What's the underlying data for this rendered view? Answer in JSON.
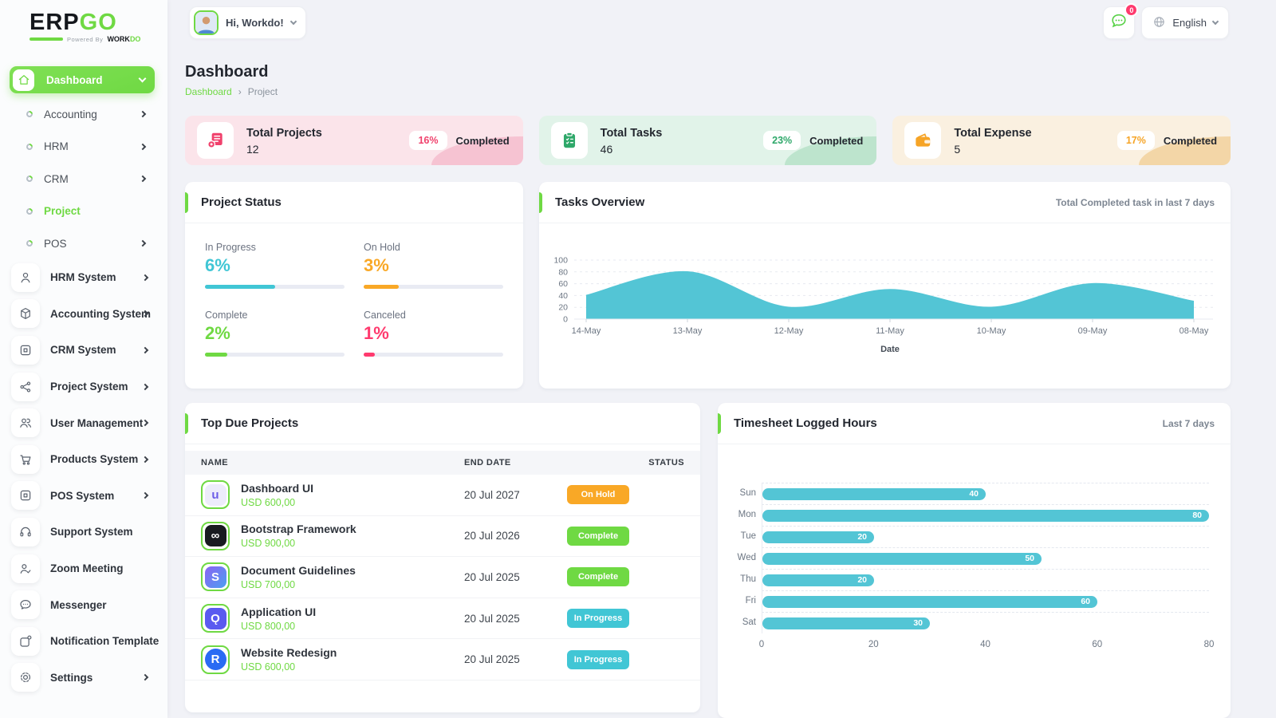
{
  "colors": {
    "primary": "#6fd943",
    "teal": "#53c5d5",
    "orange": "#f9a826",
    "pink": "#ff3a6e"
  },
  "brand": {
    "logo_erp": "ERP",
    "logo_go": "GO",
    "powered_by": "Powered By",
    "workdo_work": "WORK",
    "workdo_do": "DO"
  },
  "header": {
    "user_greeting": "Hi, Workdo!",
    "language": "English",
    "notification_count": "0"
  },
  "page": {
    "title": "Dashboard",
    "breadcrumb_home": "Dashboard",
    "breadcrumb_separator": "›",
    "breadcrumb_current": "Project"
  },
  "sidebar": {
    "dashboard_label": "Dashboard",
    "submenu": [
      {
        "label": "Accounting",
        "chevron": true,
        "active": false
      },
      {
        "label": "HRM",
        "chevron": true,
        "active": false
      },
      {
        "label": "CRM",
        "chevron": true,
        "active": false
      },
      {
        "label": "Project",
        "chevron": false,
        "active": true
      },
      {
        "label": "POS",
        "chevron": true,
        "active": false
      }
    ],
    "modules": [
      {
        "label": "HRM System",
        "icon": "user-icon",
        "chevron": true
      },
      {
        "label": "Accounting System",
        "icon": "cube-icon",
        "chevron": true
      },
      {
        "label": "CRM System",
        "icon": "display-icon",
        "chevron": true
      },
      {
        "label": "Project System",
        "icon": "share-icon",
        "chevron": true
      },
      {
        "label": "User Management",
        "icon": "users-icon",
        "chevron": true
      },
      {
        "label": "Products System",
        "icon": "cart-icon",
        "chevron": true
      },
      {
        "label": "POS System",
        "icon": "display-icon",
        "chevron": true
      },
      {
        "label": "Support System",
        "icon": "headset-icon",
        "chevron": false
      },
      {
        "label": "Zoom Meeting",
        "icon": "person-check-icon",
        "chevron": false
      },
      {
        "label": "Messenger",
        "icon": "chat-icon",
        "chevron": false
      },
      {
        "label": "Notification Template",
        "icon": "template-icon",
        "chevron": false
      },
      {
        "label": "Settings",
        "icon": "gear-icon",
        "chevron": true
      }
    ]
  },
  "stat_cards": [
    {
      "title": "Total Projects",
      "value": "12",
      "percent": "16%",
      "completed_label": "Completed",
      "icon": "projects-icon",
      "bg": "#fbe4ea",
      "corner": "#f6c3d2",
      "accent": "#f0416c"
    },
    {
      "title": "Total Tasks",
      "value": "46",
      "percent": "23%",
      "completed_label": "Completed",
      "icon": "tasks-icon",
      "bg": "#e1f3e9",
      "corner": "#bde4cd",
      "accent": "#2fa86a"
    },
    {
      "title": "Total Expense",
      "value": "5",
      "percent": "17%",
      "completed_label": "Completed",
      "icon": "wallet-icon",
      "bg": "#faf0e0",
      "corner": "#f3d6a7",
      "accent": "#f6a426"
    }
  ],
  "project_status": {
    "title": "Project Status",
    "items": [
      {
        "label": "In Progress",
        "value": "6%",
        "color": "#41c6d5",
        "fill_pct": 50
      },
      {
        "label": "On Hold",
        "value": "3%",
        "color": "#f9a826",
        "fill_pct": 25
      },
      {
        "label": "Complete",
        "value": "2%",
        "color": "#6fd943",
        "fill_pct": 16
      },
      {
        "label": "Canceled",
        "value": "1%",
        "color": "#ff3a6e",
        "fill_pct": 8
      }
    ]
  },
  "tasks_overview": {
    "title": "Tasks Overview",
    "subtitle": "Total Completed task in last 7 days"
  },
  "top_due_projects": {
    "title": "Top Due Projects",
    "columns": [
      "NAME",
      "END DATE",
      "STATUS"
    ],
    "rows": [
      {
        "name": "Dashboard UI",
        "price": "USD 600,00",
        "end_date": "20 Jul 2027",
        "status": "On Hold",
        "status_color": "#f9a826",
        "logo_bg": "#edecfb",
        "logo_glyph": "u",
        "logo_color": "#6c5ce7",
        "logo_radius": "8px"
      },
      {
        "name": "Bootstrap Framework",
        "price": "USD 900,00",
        "end_date": "20 Jul 2026",
        "status": "Complete",
        "status_color": "#6fd943",
        "logo_bg": "#181b20",
        "logo_glyph": "∞",
        "logo_color": "#ffffff",
        "logo_radius": "8px"
      },
      {
        "name": "Document Guidelines",
        "price": "USD 700,00",
        "end_date": "20 Jul 2025",
        "status": "Complete",
        "status_color": "#6fd943",
        "logo_bg": "linear-gradient(135deg,#8a63f2,#4b9ff2)",
        "logo_glyph": "S",
        "logo_color": "#ffffff",
        "logo_radius": "8px"
      },
      {
        "name": "Application UI",
        "price": "USD 800,00",
        "end_date": "20 Jul 2025",
        "status": "In Progress",
        "status_color": "#41c6d5",
        "logo_bg": "#5a5bf0",
        "logo_glyph": "Ǫ",
        "logo_color": "#ffffff",
        "logo_radius": "8px"
      },
      {
        "name": "Website Redesign",
        "price": "USD 600,00",
        "end_date": "20 Jul 2025",
        "status": "In Progress",
        "status_color": "#41c6d5",
        "logo_bg": "#2a6bf3",
        "logo_glyph": "R",
        "logo_color": "#ffffff",
        "logo_radius": "50%"
      }
    ]
  },
  "timesheet": {
    "title": "Timesheet Logged Hours",
    "subtitle": "Last 7 days"
  },
  "chart_data": [
    {
      "type": "area",
      "title": "Tasks Overview",
      "x": [
        "14-May",
        "13-May",
        "12-May",
        "11-May",
        "10-May",
        "09-May",
        "08-May"
      ],
      "values": [
        40,
        80,
        20,
        50,
        20,
        60,
        30
      ],
      "xlabel": "Date",
      "ylim": [
        0,
        100
      ],
      "yticks": [
        0,
        20,
        40,
        60,
        80,
        100
      ],
      "color": "#53c5d5",
      "grid": "horizontal-dashed",
      "legend": "none"
    },
    {
      "type": "bar",
      "orientation": "horizontal",
      "title": "Timesheet Logged Hours",
      "categories": [
        "Sun",
        "Mon",
        "Tue",
        "Wed",
        "Thu",
        "Fri",
        "Sat"
      ],
      "values": [
        40,
        80,
        20,
        50,
        20,
        60,
        30
      ],
      "xlim": [
        0,
        80
      ],
      "xticks": [
        0,
        20,
        40,
        60,
        80
      ],
      "color": "#53c5d5",
      "value_labels": true
    }
  ]
}
